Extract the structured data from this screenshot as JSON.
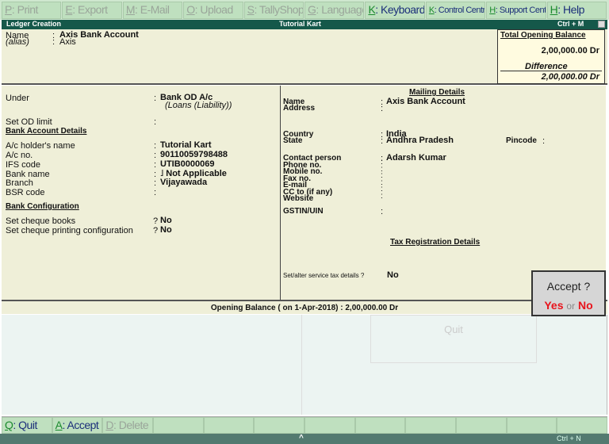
{
  "toolbar": [
    {
      "key": "P",
      "label": ": Print",
      "enabled": false
    },
    {
      "key": "E",
      "label": ": Export",
      "enabled": false
    },
    {
      "key": "M",
      "label": ": E-Mail",
      "enabled": false
    },
    {
      "key": "O",
      "label": ": Upload",
      "enabled": false
    },
    {
      "key": "S",
      "label": ": TallyShop",
      "enabled": false
    },
    {
      "key": "G",
      "label": ": Language",
      "enabled": false
    },
    {
      "key": "K",
      "label": ": Keyboard",
      "enabled": true
    },
    {
      "key": "K",
      "label": ": Control Centre",
      "enabled": true
    },
    {
      "key": "H",
      "label": ": Support Centre",
      "enabled": true
    },
    {
      "key": "H",
      "label": ": Help",
      "enabled": true
    }
  ],
  "titlebar": {
    "left": "Ledger Creation",
    "center": "Tutorial Kart",
    "right": "Ctrl + M"
  },
  "ledger": {
    "name_label": "Name",
    "name": "Axis Bank Account",
    "alias_label": "(alias)",
    "alias": "Axis"
  },
  "balance_box": {
    "title": "Total Opening Balance",
    "total": "2,00,000.00 Dr",
    "diff_label": "Difference",
    "difference": "2,00,000.00 Dr"
  },
  "left": {
    "under_label": "Under",
    "under": "Bank OD A/c",
    "under_group": "(Loans (Liability))",
    "od_label": "Set OD limit",
    "bank_details_heading": "Bank Account Details",
    "holder_label": "A/c holder's name",
    "holder": "Tutorial Kart",
    "acno_label": "A/c no.",
    "acno": "90110059798488",
    "ifs_label": "IFS code",
    "ifs": "UTIB0000069",
    "bankname_label": "Bank name",
    "bankname": "˩ Not Applicable",
    "branch_label": "Branch",
    "branch": "Vijayawada",
    "bsr_label": "BSR code",
    "bank_config_heading": "Bank Configuration",
    "cheque_books_label": "Set cheque books",
    "cheque_books": "No",
    "cheque_print_label": "Set cheque printing configuration",
    "cheque_print": "No"
  },
  "mailing": {
    "heading": "Mailing Details",
    "name_label": "Name",
    "name": "Axis Bank Account",
    "address_label": "Address",
    "country_label": "Country",
    "country": "India",
    "state_label": "State",
    "state": "Andhra Pradesh",
    "pincode_label": "Pincode",
    "contact_label": "Contact person",
    "contact": "Adarsh Kumar",
    "phone_label": "Phone no.",
    "mobile_label": "Mobile no.",
    "fax_label": "Fax no.",
    "email_label": "E-mail",
    "cc_label": "CC to (if any)",
    "website_label": "Website",
    "gstin_label": "GSTIN/UIN",
    "tax_heading": "Tax Registration Details",
    "service_tax_label": "Set/alter service tax details ?",
    "service_tax": "No"
  },
  "opening_balance": "Opening Balance ( on 1-Apr-2018) : 2,00,000.00 Dr",
  "ghost_quit": "Quit",
  "accept": {
    "title": "Accept ?",
    "yes": "Yes",
    "or": "or",
    "no": "No"
  },
  "bottombar": [
    {
      "key": "Q",
      "label": ": Quit",
      "enabled": true
    },
    {
      "key": "A",
      "label": ": Accept",
      "enabled": true
    },
    {
      "key": "D",
      "label": ": Delete",
      "enabled": false
    }
  ],
  "status": {
    "right": "Ctrl + N"
  },
  "colors": {
    "titlebar": "#15584a",
    "toolbar": "#bfe0bf",
    "panel": "#efefd8",
    "yes_no": "#e8141c"
  }
}
